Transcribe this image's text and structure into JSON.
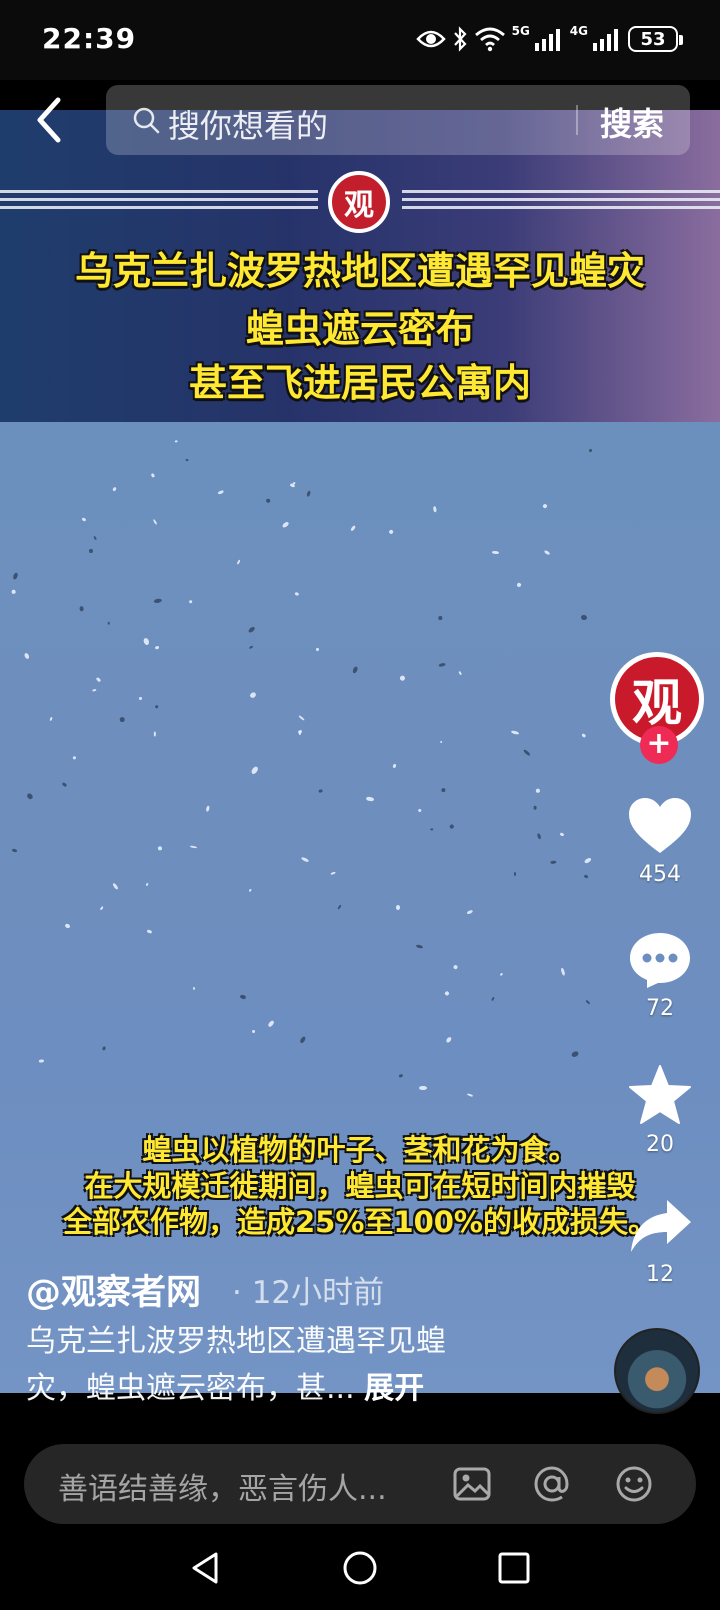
{
  "status_bar": {
    "time": "22:39",
    "signal_5g": "5G",
    "signal_4g": "4G",
    "battery": "53"
  },
  "search": {
    "placeholder": "搜你想看的",
    "button_label": "搜索"
  },
  "video": {
    "title_line1": "乌克兰扎波罗热地区遭遇罕见蝗灾",
    "title_line2": "蝗虫遮云密布",
    "title_line3": "甚至飞进居民公寓内",
    "logo_char": "观",
    "caption_line1": "蝗虫以植物的叶子、茎和花为食。",
    "caption_line2": "在大规模迁徙期间，蝗虫可在短时间内摧毁",
    "caption_line3": "全部农作物，造成25%至100%的收成损失。"
  },
  "author": {
    "name": "@观察者网",
    "time_ago": "· 12小时前",
    "avatar_char": "观"
  },
  "description": {
    "line1": "乌克兰扎波罗热地区遭遇罕见蝗",
    "line2": "灾，蝗虫遮云密布，甚...",
    "expand_label": "展开"
  },
  "actions": {
    "likes": "454",
    "comments": "72",
    "favorites": "20",
    "shares": "12",
    "follow_symbol": "+"
  },
  "comment_input": {
    "placeholder": "善语结善缘，恶言伤人..."
  },
  "icons": [
    "back-icon",
    "search-icon",
    "heart-icon",
    "comment-icon",
    "star-icon",
    "share-icon",
    "image-icon",
    "at-icon",
    "emoji-icon",
    "nav-back-icon",
    "nav-home-icon",
    "nav-recent-icon"
  ]
}
